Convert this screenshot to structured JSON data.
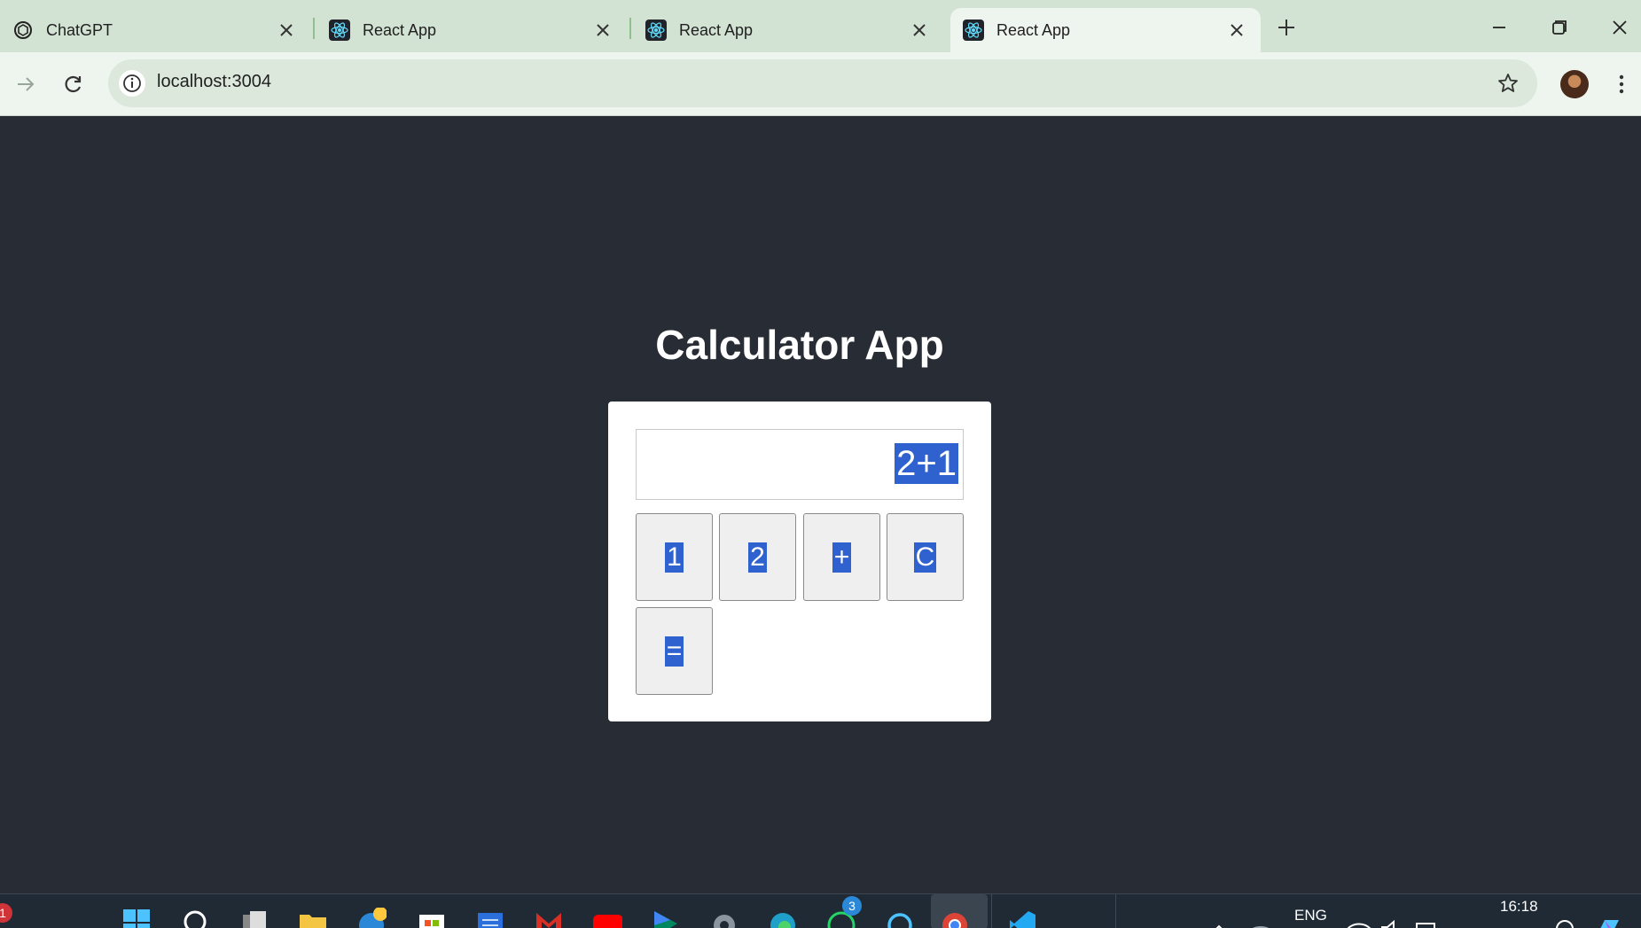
{
  "browser": {
    "tabs": [
      {
        "title": "ChatGPT",
        "icon": "chatgpt-icon",
        "active": false
      },
      {
        "title": "React App",
        "icon": "react-icon",
        "active": false
      },
      {
        "title": "React App",
        "icon": "react-icon",
        "active": false
      },
      {
        "title": "React App",
        "icon": "react-icon",
        "active": true
      }
    ],
    "address": "localhost:3004"
  },
  "app": {
    "title": "Calculator App",
    "display_value": "2+1",
    "keys": [
      "1",
      "2",
      "+",
      "C",
      "="
    ]
  },
  "taskbar": {
    "notification_count": "1",
    "whatsapp_badge": "3",
    "language": "ENG",
    "time": "16:18"
  },
  "colors": {
    "page_background": "#282c34",
    "selection": "#2f62cf",
    "tabstrip": "#d3e3d3",
    "toolbar": "#eef4ee"
  }
}
